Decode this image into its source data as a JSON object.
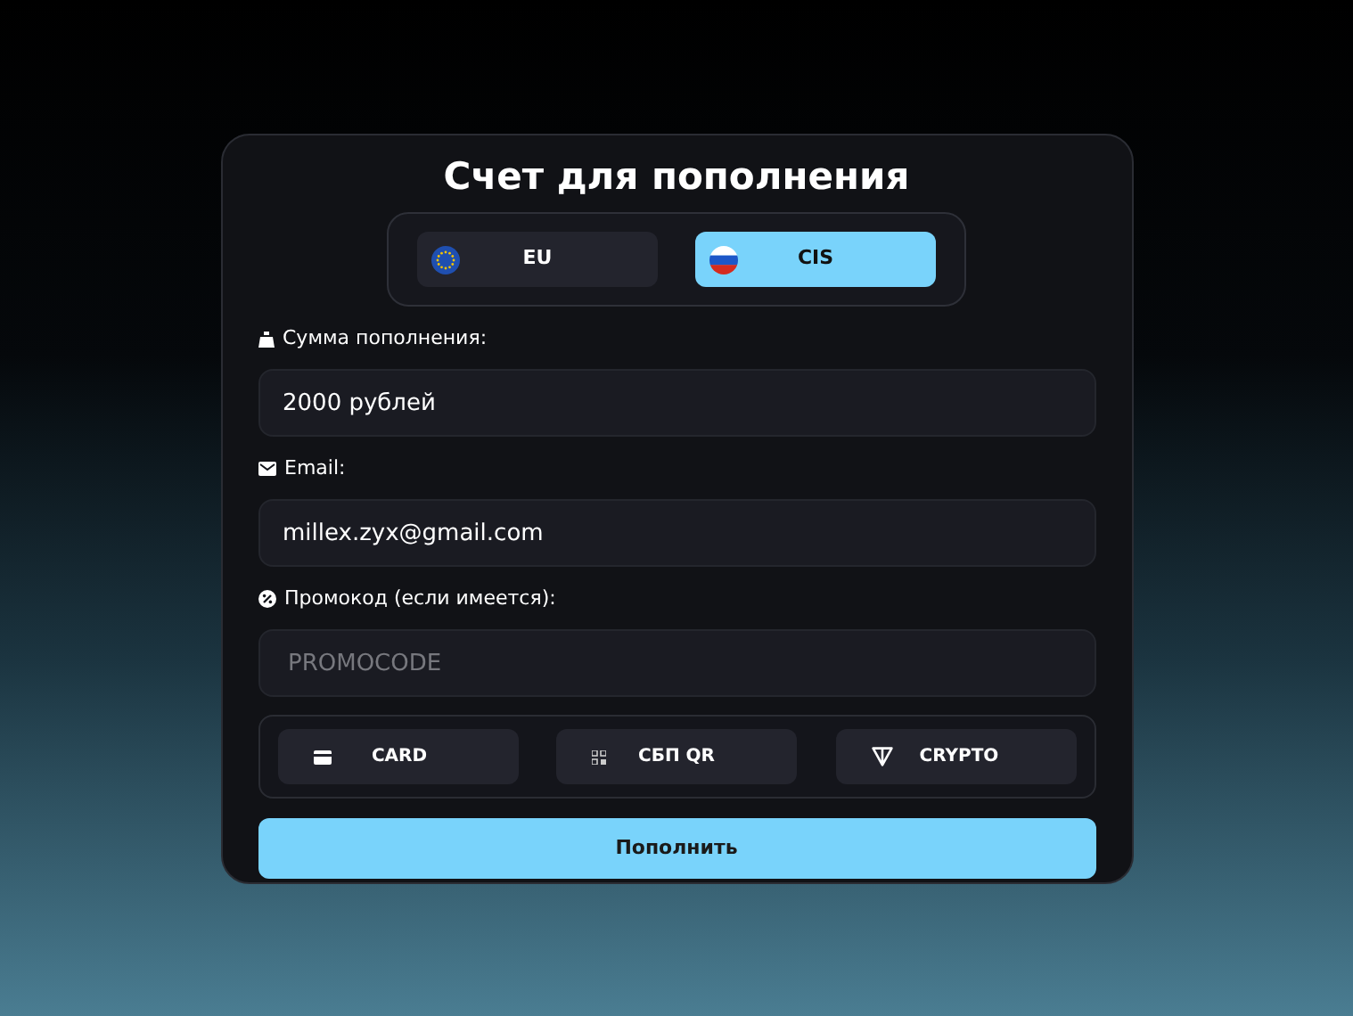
{
  "title": "Счет для пополнения",
  "regions": [
    {
      "label": "EU",
      "kind": "eu",
      "selected": false
    },
    {
      "label": "CIS",
      "kind": "ru",
      "selected": true
    }
  ],
  "fields": [
    {
      "label": "Сумма пополнения:",
      "kind": "amount",
      "value": "2000 рублей"
    },
    {
      "label": "Email:",
      "kind": "email",
      "value": "millex.zyx@gmail.com"
    },
    {
      "label": "Промокод (если имеется):",
      "kind": "promo",
      "placeholder": "PROMOCODE"
    }
  ],
  "methods": [
    {
      "label": "CARD",
      "kind": "card",
      "selected": false
    },
    {
      "label": "СБП QR",
      "kind": "qr",
      "selected": false
    },
    {
      "label": "CRYPTO",
      "kind": "crypto",
      "selected": false
    }
  ],
  "submit": "Пополнить"
}
